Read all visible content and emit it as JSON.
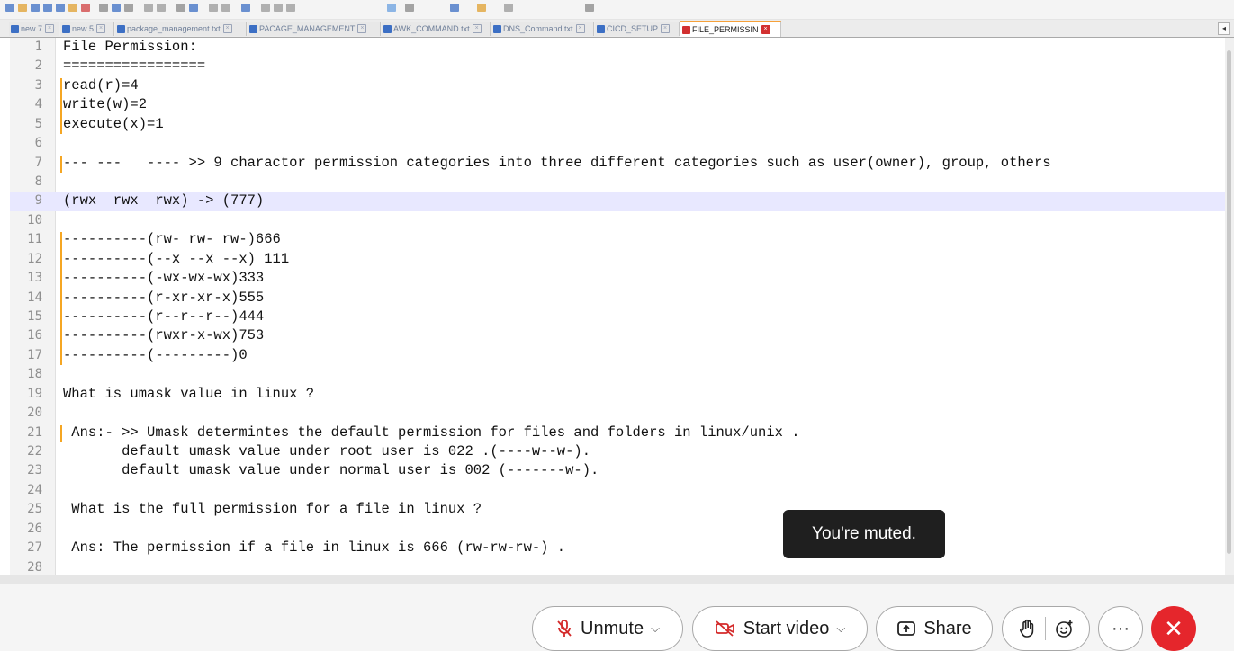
{
  "tabs": [
    {
      "label": "new 7",
      "active": false
    },
    {
      "label": "new 5",
      "active": false
    },
    {
      "label": "package_management.txt",
      "active": false
    },
    {
      "label": "PACAGE_MANAGEMENT",
      "active": false
    },
    {
      "label": "AWK_COMMAND.txt",
      "active": false
    },
    {
      "label": "DNS_Command.txt",
      "active": false
    },
    {
      "label": "CICD_SETUP",
      "active": false
    },
    {
      "label": "FILE_PERMISSIN",
      "active": true
    }
  ],
  "editor": {
    "current_line": 9,
    "lines": [
      {
        "n": "1",
        "text": "File Permission:"
      },
      {
        "n": "2",
        "text": "================="
      },
      {
        "n": "3",
        "text": "read(r)=4"
      },
      {
        "n": "4",
        "text": "write(w)=2"
      },
      {
        "n": "5",
        "text": "execute(x)=1"
      },
      {
        "n": "6",
        "text": ""
      },
      {
        "n": "7",
        "text": "--- ---   ---- >> 9 charactor permission categories into three different categories such as user(owner), group, others"
      },
      {
        "n": "8",
        "text": ""
      },
      {
        "n": "9",
        "text": "(rwx  rwx  rwx) -> (777)"
      },
      {
        "n": "10",
        "text": ""
      },
      {
        "n": "11",
        "text": "----------(rw- rw- rw-)666"
      },
      {
        "n": "12",
        "text": "----------(--x --x --x) 111"
      },
      {
        "n": "13",
        "text": "----------(-wx-wx-wx)333"
      },
      {
        "n": "14",
        "text": "----------(r-xr-xr-x)555"
      },
      {
        "n": "15",
        "text": "----------(r--r--r--)444"
      },
      {
        "n": "16",
        "text": "----------(rwxr-x-wx)753"
      },
      {
        "n": "17",
        "text": "----------(---------)0"
      },
      {
        "n": "18",
        "text": ""
      },
      {
        "n": "19",
        "text": "What is umask value in linux ?"
      },
      {
        "n": "20",
        "text": ""
      },
      {
        "n": "21",
        "text": " Ans:- >> Umask determintes the default permission for files and folders in linux/unix ."
      },
      {
        "n": "22",
        "text": "       default umask value under root user is 022 .(----w--w-)."
      },
      {
        "n": "23",
        "text": "       default umask value under normal user is 002 (-------w-)."
      },
      {
        "n": "24",
        "text": ""
      },
      {
        "n": "25",
        "text": " What is the full permission for a file in linux ?"
      },
      {
        "n": "26",
        "text": ""
      },
      {
        "n": "27",
        "text": " Ans: The permission if a file in linux is 666 (rw-rw-rw-) ."
      },
      {
        "n": "28",
        "text": ""
      }
    ]
  },
  "toast": {
    "text": "You're muted."
  },
  "controls": {
    "unmute_label": "Unmute",
    "start_video_label": "Start video",
    "share_label": "Share",
    "more_label": "···"
  },
  "colors": {
    "accent_orange": "#f5a623",
    "current_line": "#e8e8ff",
    "end_call_red": "#e5262c"
  }
}
